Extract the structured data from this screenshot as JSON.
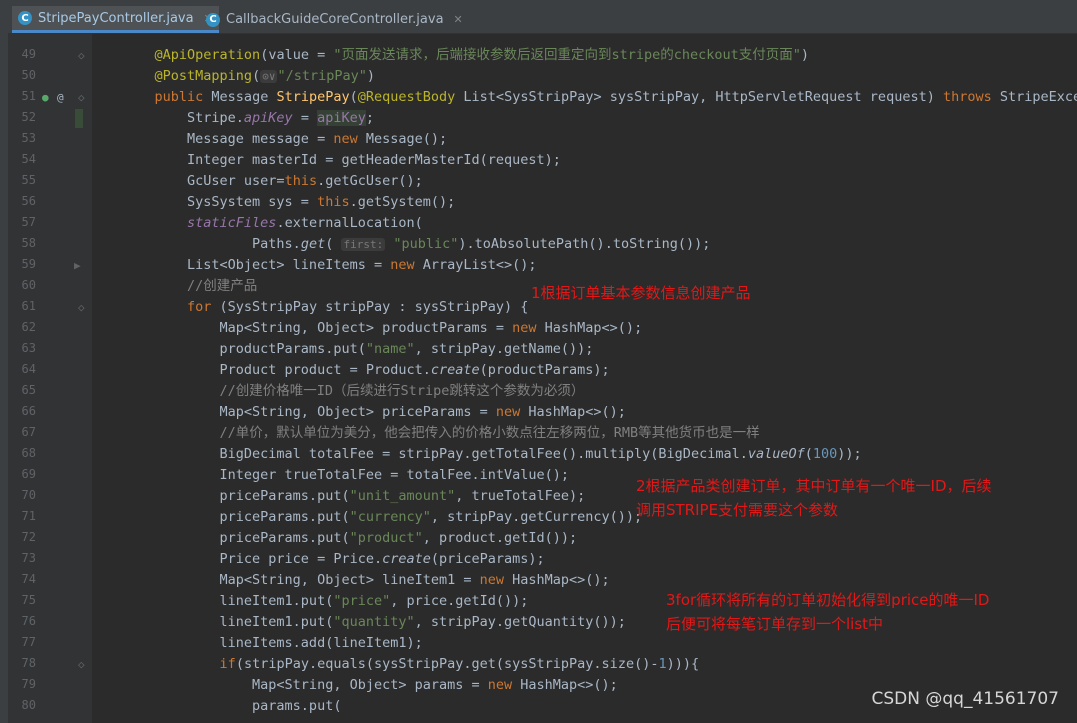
{
  "tabs": [
    {
      "label": "StripePayController.java",
      "active": true
    },
    {
      "label": "CallbackGuideCoreController.java",
      "active": false
    }
  ],
  "lines": [
    {
      "num": "49",
      "html": "    <span class=\"an\">@ApiOperation</span>(value = <span class=\"st\">\"页面发送请求，后端接收参数后返回重定向到stripe的checkout支付页面\"</span>)"
    },
    {
      "num": "50",
      "html": "    <span class=\"an\">@PostMapping</span>(<span class=\"hint\">⊙∨</span><span class=\"st\">\"/stripPay\"</span>)"
    },
    {
      "num": "51",
      "html": "    <span class=\"kw\">public</span> Message <span class=\"fn\">StripePay</span>(<span class=\"an\">@RequestBody</span> List&lt;SysStripPay&gt; sysStripPay, HttpServletRequest request) <span class=\"kw\">throws</span> StripeExcept"
    },
    {
      "num": "52",
      "html": "        Stripe.<span class=\"fi\">apiKey</span> = <span style=\"color:#9876aa;background:#344134\">apiKey</span>;"
    },
    {
      "num": "53",
      "html": "        Message message = <span class=\"kw\">new</span> Message();"
    },
    {
      "num": "54",
      "html": "        Integer masterId = getHeaderMasterId(request);"
    },
    {
      "num": "55",
      "html": "        GcUser user=<span class=\"kw\">this</span>.getGcUser();"
    },
    {
      "num": "56",
      "html": "        SysSystem sys = <span class=\"kw\">this</span>.getSystem();"
    },
    {
      "num": "57",
      "html": "        <span class=\"fi\">staticFiles</span>.externalLocation("
    },
    {
      "num": "58",
      "html": "                Paths.<span class=\"it\">get</span>( <span class=\"hint\">first:</span> <span class=\"st\">\"public\"</span>).toAbsolutePath().toString());"
    },
    {
      "num": "59",
      "html": "        List&lt;Object&gt; lineItems = <span class=\"kw\">new</span> ArrayList&lt;&gt;();"
    },
    {
      "num": "60",
      "html": "        <span class=\"cm\">//创建产品</span>"
    },
    {
      "num": "61",
      "html": "        <span class=\"kw\">for</span> (SysStripPay stripPay : sysStripPay) {"
    },
    {
      "num": "62",
      "html": "            Map&lt;String, Object&gt; productParams = <span class=\"kw\">new</span> HashMap&lt;&gt;();"
    },
    {
      "num": "63",
      "html": "            productParams.put(<span class=\"st\">\"name\"</span>, stripPay.getName());"
    },
    {
      "num": "64",
      "html": "            Product product = Product.<span class=\"it\">create</span>(productParams);"
    },
    {
      "num": "65",
      "html": "            <span class=\"cm\">//创建价格唯一ID（后续进行Stripe跳转这个参数为必须）</span>"
    },
    {
      "num": "66",
      "html": "            Map&lt;String, Object&gt; priceParams = <span class=\"kw\">new</span> HashMap&lt;&gt;();"
    },
    {
      "num": "67",
      "html": "            <span class=\"cm\">//单价，默认单位为美分，他会把传入的价格小数点往左移两位，RMB等其他货币也是一样</span>"
    },
    {
      "num": "68",
      "html": "            BigDecimal totalFee = stripPay.getTotalFee().multiply(BigDecimal.<span class=\"it\">valueOf</span>(<span class=\"nu\">100</span>));"
    },
    {
      "num": "69",
      "html": "            Integer trueTotalFee = totalFee.intValue();"
    },
    {
      "num": "70",
      "html": "            priceParams.put(<span class=\"st\">\"unit_amount\"</span>, trueTotalFee);"
    },
    {
      "num": "71",
      "html": "            priceParams.put(<span class=\"st\">\"currency\"</span>, stripPay.getCurrency());"
    },
    {
      "num": "72",
      "html": "            priceParams.put(<span class=\"st\">\"product\"</span>, product.getId());"
    },
    {
      "num": "73",
      "html": "            Price price = Price.<span class=\"it\">create</span>(priceParams);"
    },
    {
      "num": "74",
      "html": "            Map&lt;String, Object&gt; lineItem1 = <span class=\"kw\">new</span> HashMap&lt;&gt;();"
    },
    {
      "num": "75",
      "html": "            lineItem1.put(<span class=\"st\">\"price\"</span>, price.getId());"
    },
    {
      "num": "76",
      "html": "            lineItem1.put(<span class=\"st\">\"quantity\"</span>, stripPay.getQuantity());"
    },
    {
      "num": "77",
      "html": "            lineItems.add(lineItem1);"
    },
    {
      "num": "78",
      "html": "            <span class=\"kw\">if</span>(stripPay.equals(sysStripPay.get(sysStripPay.size()-<span class=\"nu\">1</span>))){"
    },
    {
      "num": "79",
      "html": "                Map&lt;String, Object&gt; params = <span class=\"kw\">new</span> HashMap&lt;&gt;();"
    },
    {
      "num": "80",
      "html": "                params.put("
    }
  ],
  "annotations": {
    "a1": "1根据订单基本参数信息创建产品",
    "a2_line1": "2根据产品类创建订单，其中订单有一个唯一ID，后续",
    "a2_line2": "调用STRIPE支付需要这个参数",
    "a3_line1": "3for循环将所有的订单初始化得到price的唯一ID",
    "a3_line2": "后便可将每笔订单存到一个list中"
  },
  "watermark": "CSDN @qq_41561707",
  "colors": {
    "keyword": "#cc7832",
    "annotation_text": "#e21818",
    "tab_accent": "#4a88c7"
  }
}
